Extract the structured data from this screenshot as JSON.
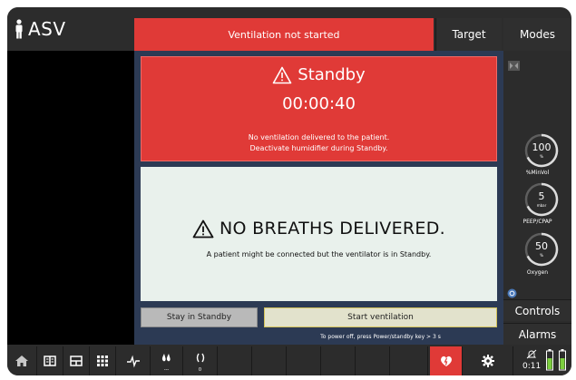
{
  "header": {
    "mode_label": "ASV",
    "status_banner": "Ventilation not started",
    "target_label": "Target",
    "modes_label": "Modes"
  },
  "standby_panel": {
    "title": "Standby",
    "timer": "00:00:40",
    "message_line1": "No ventilation delivered to the patient.",
    "message_line2": "Deactivate humidifier during Standby."
  },
  "alarm_panel": {
    "title": "NO BREATHS DELIVERED.",
    "subtitle": "A patient might be connected but the ventilator is in Standby."
  },
  "actions": {
    "stay_label": "Stay in Standby",
    "start_label": "Start ventilation",
    "power_hint": "To power off,  press Power/standby key > 3 s"
  },
  "controls": [
    {
      "value": "100",
      "unit": "%",
      "label": "%MinVol"
    },
    {
      "value": "5",
      "unit": "mbar",
      "label": "PEEP/CPAP"
    },
    {
      "value": "50",
      "unit": "%",
      "label": "Oxygen"
    }
  ],
  "side_buttons": {
    "controls_label": "Controls",
    "alarms_label": "Alarms"
  },
  "bottom_bar": {
    "humidifier_value": "---",
    "nebulizer_value": "0",
    "time": "0:11"
  },
  "colors": {
    "alert_red": "#e03a37",
    "panel_navy": "#2c3a54",
    "alarm_bg": "#e9f1ec",
    "battery_green": "#7ccf3e"
  }
}
